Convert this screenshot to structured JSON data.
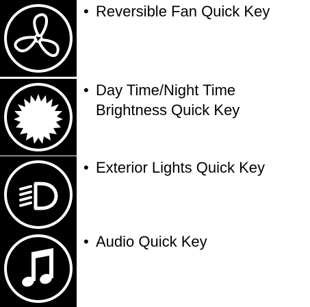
{
  "colors": {
    "tile_background": "#000000",
    "icon_stroke": "#ffffff",
    "page_background": "#ffffff"
  },
  "items": [
    {
      "icon": "fan-icon",
      "label": "Reversible Fan Quick Key"
    },
    {
      "icon": "brightness-sun-icon",
      "label": "Day Time/Night Time\nBrightness Quick Key"
    },
    {
      "icon": "exterior-lights-icon",
      "label": "Exterior Lights Quick Key"
    },
    {
      "icon": "audio-note-icon",
      "label": "Audio Quick Key"
    }
  ]
}
